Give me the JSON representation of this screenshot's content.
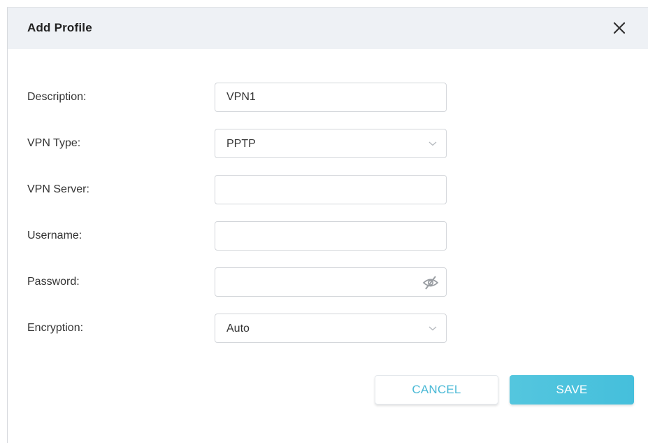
{
  "dialog": {
    "title": "Add Profile"
  },
  "form": {
    "description": {
      "label": "Description:",
      "value": "VPN1"
    },
    "vpn_type": {
      "label": "VPN Type:",
      "value": "PPTP"
    },
    "vpn_server": {
      "label": "VPN Server:",
      "value": ""
    },
    "username": {
      "label": "Username:",
      "value": ""
    },
    "password": {
      "label": "Password:",
      "value": ""
    },
    "encryption": {
      "label": "Encryption:",
      "value": "Auto"
    }
  },
  "buttons": {
    "cancel": "CANCEL",
    "save": "SAVE"
  },
  "icons": {
    "close": "close-icon",
    "chevron": "chevron-down-icon",
    "visibility": "eye-off-icon"
  },
  "colors": {
    "accent": "#4ab9d6",
    "header_bg": "#eef1f5",
    "save_bg": "#4ec3dd"
  }
}
